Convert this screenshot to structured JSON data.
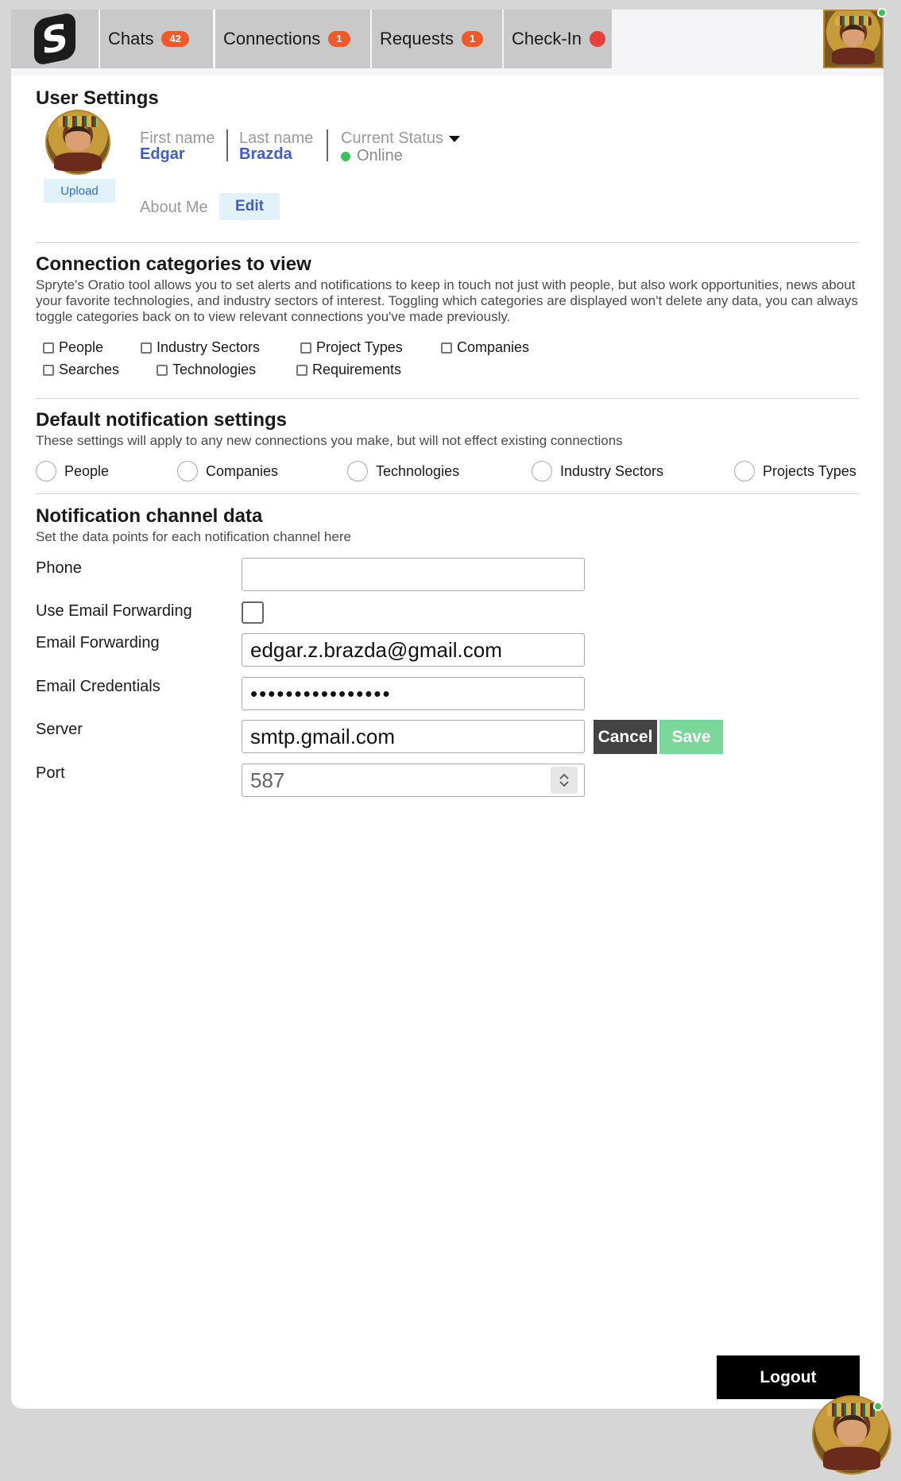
{
  "nav": {
    "logo_letter": "S",
    "tabs": [
      {
        "label": "Chats",
        "badge": "42"
      },
      {
        "label": "Connections",
        "badge": "1"
      },
      {
        "label": "Requests",
        "badge": "1"
      },
      {
        "label": "Check-In"
      }
    ]
  },
  "user_settings": {
    "title": "User Settings",
    "upload_label": "Upload",
    "first_name_label": "First name",
    "first_name": "Edgar",
    "last_name_label": "Last name",
    "last_name": "Brazda",
    "status_label": "Current Status",
    "status_value": "Online",
    "about_label": "About Me",
    "edit_label": "Edit"
  },
  "categories": {
    "title": "Connection categories to view",
    "description": "Spryte's Oratio tool allows you to set alerts and notifications to keep in touch not just with people, but also work opportunities, news about your favorite technologies, and industry sectors of interest. Toggling which categories are displayed won't delete any data, you can always toggle categories back on to view relevant connections you've made previously.",
    "items": [
      "People",
      "Industry Sectors",
      "Project Types",
      "Companies",
      "Searches",
      "Technologies",
      "Requirements"
    ]
  },
  "notifications": {
    "title": "Default notification settings",
    "description": "These settings will apply to any new connections you make, but will not effect existing connections",
    "options": [
      "People",
      "Companies",
      "Technologies",
      "Industry Sectors",
      "Projects Types"
    ]
  },
  "channel": {
    "title": "Notification channel data",
    "description": "Set the data points for each notification channel here",
    "phone_label": "Phone",
    "phone_value": "",
    "use_forwarding_label": "Use Email Forwarding",
    "forwarding_label": "Email Forwarding",
    "forwarding_value": "edgar.z.brazda@gmail.com",
    "credentials_label": "Email Credentials",
    "credentials_value": "••••••••••••••••",
    "server_label": "Server",
    "server_value": "smtp.gmail.com",
    "port_label": "Port",
    "port_value": "587",
    "cancel_label": "Cancel",
    "save_label": "Save"
  },
  "logout_label": "Logout",
  "colors": {
    "accent": "#3f5ec4",
    "badge": "#f05a28",
    "online": "#3bc25a",
    "save": "#7bd69a"
  }
}
